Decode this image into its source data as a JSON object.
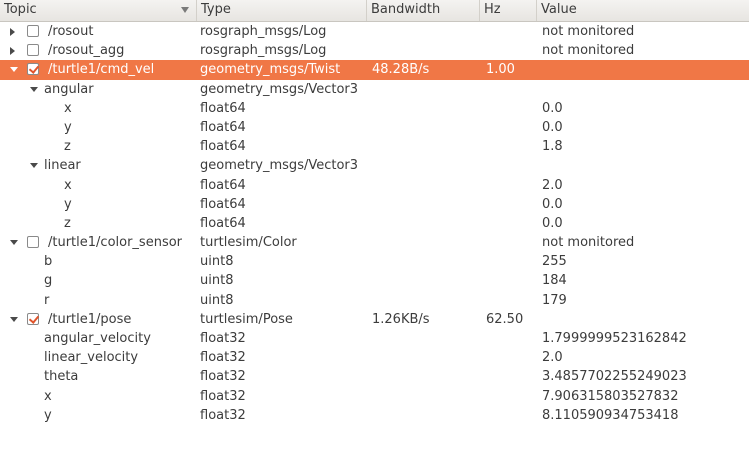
{
  "header": {
    "topic": "Topic",
    "type": "Type",
    "bandwidth": "Bandwidth",
    "hz": "Hz",
    "value": "Value",
    "sort_icon": "sort-descending-icon"
  },
  "colors": {
    "selection": "#f07746",
    "checkmark": "#e0542b"
  },
  "rows": [
    {
      "level": 0,
      "expander": "collapsed",
      "checkbox": "unchecked",
      "topic": "/rosout",
      "type": "rosgraph_msgs/Log",
      "bandwidth": "",
      "hz": "",
      "value": "not monitored",
      "selected": false
    },
    {
      "level": 0,
      "expander": "collapsed",
      "checkbox": "unchecked",
      "topic": "/rosout_agg",
      "type": "rosgraph_msgs/Log",
      "bandwidth": "",
      "hz": "",
      "value": "not monitored",
      "selected": false
    },
    {
      "level": 0,
      "expander": "expanded",
      "checkbox": "checked",
      "topic": "/turtle1/cmd_vel",
      "type": "geometry_msgs/Twist",
      "bandwidth": "48.28B/s",
      "hz": "1.00",
      "value": "",
      "selected": true
    },
    {
      "level": 1,
      "expander": "expanded",
      "checkbox": "none",
      "topic": "angular",
      "type": "geometry_msgs/Vector3",
      "bandwidth": "",
      "hz": "",
      "value": "",
      "selected": false
    },
    {
      "level": 2,
      "expander": "none",
      "checkbox": "none",
      "topic": "x",
      "type": "float64",
      "bandwidth": "",
      "hz": "",
      "value": "0.0",
      "selected": false
    },
    {
      "level": 2,
      "expander": "none",
      "checkbox": "none",
      "topic": "y",
      "type": "float64",
      "bandwidth": "",
      "hz": "",
      "value": "0.0",
      "selected": false
    },
    {
      "level": 2,
      "expander": "none",
      "checkbox": "none",
      "topic": "z",
      "type": "float64",
      "bandwidth": "",
      "hz": "",
      "value": "1.8",
      "selected": false
    },
    {
      "level": 1,
      "expander": "expanded",
      "checkbox": "none",
      "topic": "linear",
      "type": "geometry_msgs/Vector3",
      "bandwidth": "",
      "hz": "",
      "value": "",
      "selected": false
    },
    {
      "level": 2,
      "expander": "none",
      "checkbox": "none",
      "topic": "x",
      "type": "float64",
      "bandwidth": "",
      "hz": "",
      "value": "2.0",
      "selected": false
    },
    {
      "level": 2,
      "expander": "none",
      "checkbox": "none",
      "topic": "y",
      "type": "float64",
      "bandwidth": "",
      "hz": "",
      "value": "0.0",
      "selected": false
    },
    {
      "level": 2,
      "expander": "none",
      "checkbox": "none",
      "topic": "z",
      "type": "float64",
      "bandwidth": "",
      "hz": "",
      "value": "0.0",
      "selected": false
    },
    {
      "level": 0,
      "expander": "expanded",
      "checkbox": "unchecked",
      "topic": "/turtle1/color_sensor",
      "type": "turtlesim/Color",
      "bandwidth": "",
      "hz": "",
      "value": "not monitored",
      "selected": false
    },
    {
      "level": 1,
      "expander": "none",
      "checkbox": "none",
      "topic": "b",
      "type": "uint8",
      "bandwidth": "",
      "hz": "",
      "value": "255",
      "selected": false
    },
    {
      "level": 1,
      "expander": "none",
      "checkbox": "none",
      "topic": "g",
      "type": "uint8",
      "bandwidth": "",
      "hz": "",
      "value": "184",
      "selected": false
    },
    {
      "level": 1,
      "expander": "none",
      "checkbox": "none",
      "topic": "r",
      "type": "uint8",
      "bandwidth": "",
      "hz": "",
      "value": "179",
      "selected": false
    },
    {
      "level": 0,
      "expander": "expanded",
      "checkbox": "checked",
      "topic": "/turtle1/pose",
      "type": "turtlesim/Pose",
      "bandwidth": "1.26KB/s",
      "hz": "62.50",
      "value": "",
      "selected": false
    },
    {
      "level": 1,
      "expander": "none",
      "checkbox": "none",
      "topic": "angular_velocity",
      "type": "float32",
      "bandwidth": "",
      "hz": "",
      "value": "1.7999999523162842",
      "selected": false
    },
    {
      "level": 1,
      "expander": "none",
      "checkbox": "none",
      "topic": "linear_velocity",
      "type": "float32",
      "bandwidth": "",
      "hz": "",
      "value": "2.0",
      "selected": false
    },
    {
      "level": 1,
      "expander": "none",
      "checkbox": "none",
      "topic": "theta",
      "type": "float32",
      "bandwidth": "",
      "hz": "",
      "value": "3.4857702255249023",
      "selected": false
    },
    {
      "level": 1,
      "expander": "none",
      "checkbox": "none",
      "topic": "x",
      "type": "float32",
      "bandwidth": "",
      "hz": "",
      "value": "7.906315803527832",
      "selected": false
    },
    {
      "level": 1,
      "expander": "none",
      "checkbox": "none",
      "topic": "y",
      "type": "float32",
      "bandwidth": "",
      "hz": "",
      "value": "8.110590934753418",
      "selected": false
    }
  ]
}
